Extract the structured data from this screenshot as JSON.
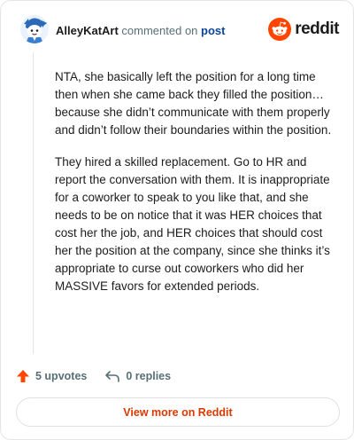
{
  "header": {
    "author": "AlleyKatArt",
    "verb": "commented on",
    "post_link": "post",
    "brand_name": "reddit"
  },
  "comment": {
    "paragraphs": [
      "NTA, she basically left the position for a long time then when she came back they filled the position… because she didn’t communicate with them properly and didn’t follow their boundaries within the position.",
      "They hired a skilled replacement. Go to HR and report the conversation with them. It is inappropriate for a coworker to speak to you like that, and she needs to be on notice that it was HER choices that cost her the job, and HER choices that should cost her the position at the company, since she thinks it’s appropriate to curse out coworkers who did her MASSIVE favors for extended periods."
    ]
  },
  "actions": {
    "upvotes_label": "5 upvotes",
    "replies_label": "0 replies"
  },
  "footer": {
    "view_more_label": "View more on Reddit"
  },
  "colors": {
    "brand_orange": "#ff4500",
    "link_blue": "#0a449b",
    "muted": "#576f76",
    "cta": "#d93a00"
  },
  "icons": {
    "avatar": "snoo-avatar",
    "brand": "reddit-logo-icon",
    "upvote": "upvote-arrow-icon",
    "reply": "reply-arrow-icon"
  }
}
